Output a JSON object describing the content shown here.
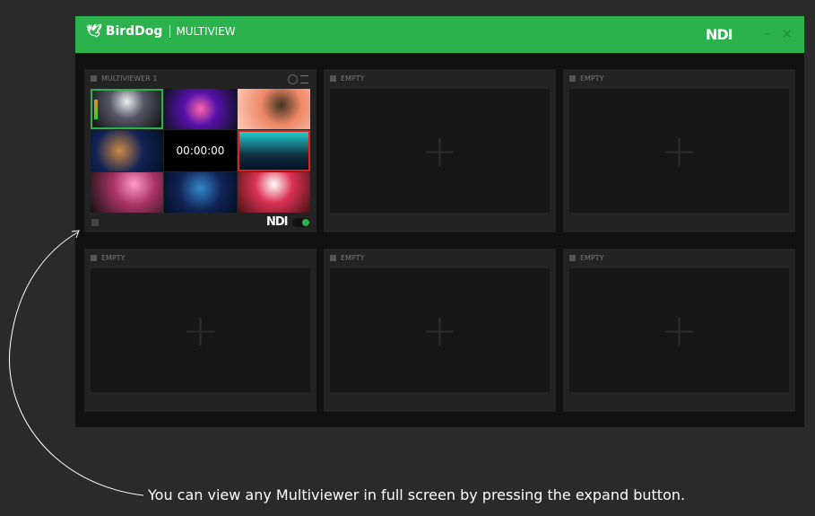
{
  "header": {
    "brand": "BirdDog",
    "app": "MULTIVIEW",
    "ndi": "NDI",
    "minimize": "–",
    "close": "×"
  },
  "panels": [
    {
      "title": "MULTIVIEWER 1",
      "timecode": "00:00:00",
      "ndi": "NDI",
      "status_color": "#2bb24c"
    },
    {
      "title": "EMPTY"
    },
    {
      "title": "EMPTY"
    },
    {
      "title": "EMPTY"
    },
    {
      "title": "EMPTY"
    },
    {
      "title": "EMPTY"
    }
  ],
  "caption": "You can view any Multiviewer in full screen by pressing the expand button.",
  "colors": {
    "accent": "#2bb24c",
    "program": "#2bb24c",
    "preview": "#e02020"
  }
}
